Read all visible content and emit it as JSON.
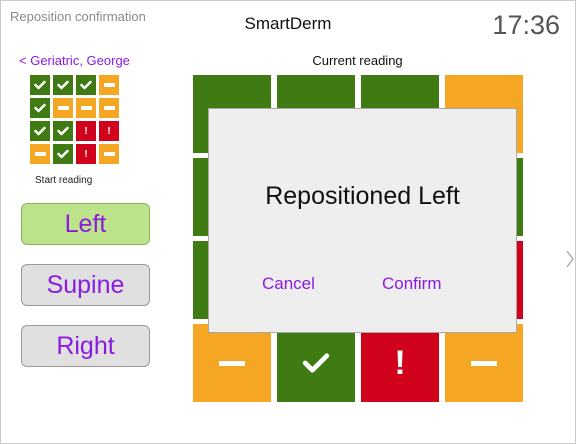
{
  "window": {
    "title": "Reposition confirmation"
  },
  "header": {
    "app_title": "SmartDerm",
    "time": "17:36"
  },
  "patient": {
    "back_label": "< Geriatric, George"
  },
  "start_reading": {
    "label": "Start reading",
    "cells": [
      {
        "status": "green",
        "icon": "check-icon"
      },
      {
        "status": "green",
        "icon": "check-icon"
      },
      {
        "status": "green",
        "icon": "check-icon"
      },
      {
        "status": "orange",
        "icon": "dash-icon"
      },
      {
        "status": "green",
        "icon": "check-icon"
      },
      {
        "status": "orange",
        "icon": "dash-icon"
      },
      {
        "status": "orange",
        "icon": "dash-icon"
      },
      {
        "status": "orange",
        "icon": "dash-icon"
      },
      {
        "status": "green",
        "icon": "check-icon"
      },
      {
        "status": "green",
        "icon": "check-icon"
      },
      {
        "status": "red",
        "icon": "exclamation-icon"
      },
      {
        "status": "red",
        "icon": "exclamation-icon"
      },
      {
        "status": "orange",
        "icon": "dash-icon"
      },
      {
        "status": "green",
        "icon": "check-icon"
      },
      {
        "status": "red",
        "icon": "exclamation-icon"
      },
      {
        "status": "orange",
        "icon": "dash-icon"
      }
    ]
  },
  "positions": {
    "left": "Left",
    "supine": "Supine",
    "right": "Right",
    "selected": "left"
  },
  "current_reading": {
    "label": "Current reading",
    "cells": [
      {
        "status": "green",
        "icon": ""
      },
      {
        "status": "green",
        "icon": ""
      },
      {
        "status": "green",
        "icon": ""
      },
      {
        "status": "orange",
        "icon": ""
      },
      {
        "status": "green",
        "icon": ""
      },
      {
        "status": "green",
        "icon": ""
      },
      {
        "status": "green",
        "icon": ""
      },
      {
        "status": "green",
        "icon": ""
      },
      {
        "status": "green",
        "icon": ""
      },
      {
        "status": "green",
        "icon": ""
      },
      {
        "status": "green",
        "icon": ""
      },
      {
        "status": "red",
        "icon": ""
      },
      {
        "status": "orange",
        "icon": "dash-icon"
      },
      {
        "status": "green",
        "icon": "check-icon"
      },
      {
        "status": "red",
        "icon": "exclamation-icon"
      },
      {
        "status": "orange",
        "icon": "dash-icon"
      }
    ]
  },
  "modal": {
    "title": "Repositioned Left",
    "cancel_label": "Cancel",
    "confirm_label": "Confirm"
  },
  "colors": {
    "green": "#3f7a12",
    "orange": "#f5a623",
    "red": "#d0021b",
    "accent": "#8b1be0",
    "selected_button": "#bde38a"
  }
}
